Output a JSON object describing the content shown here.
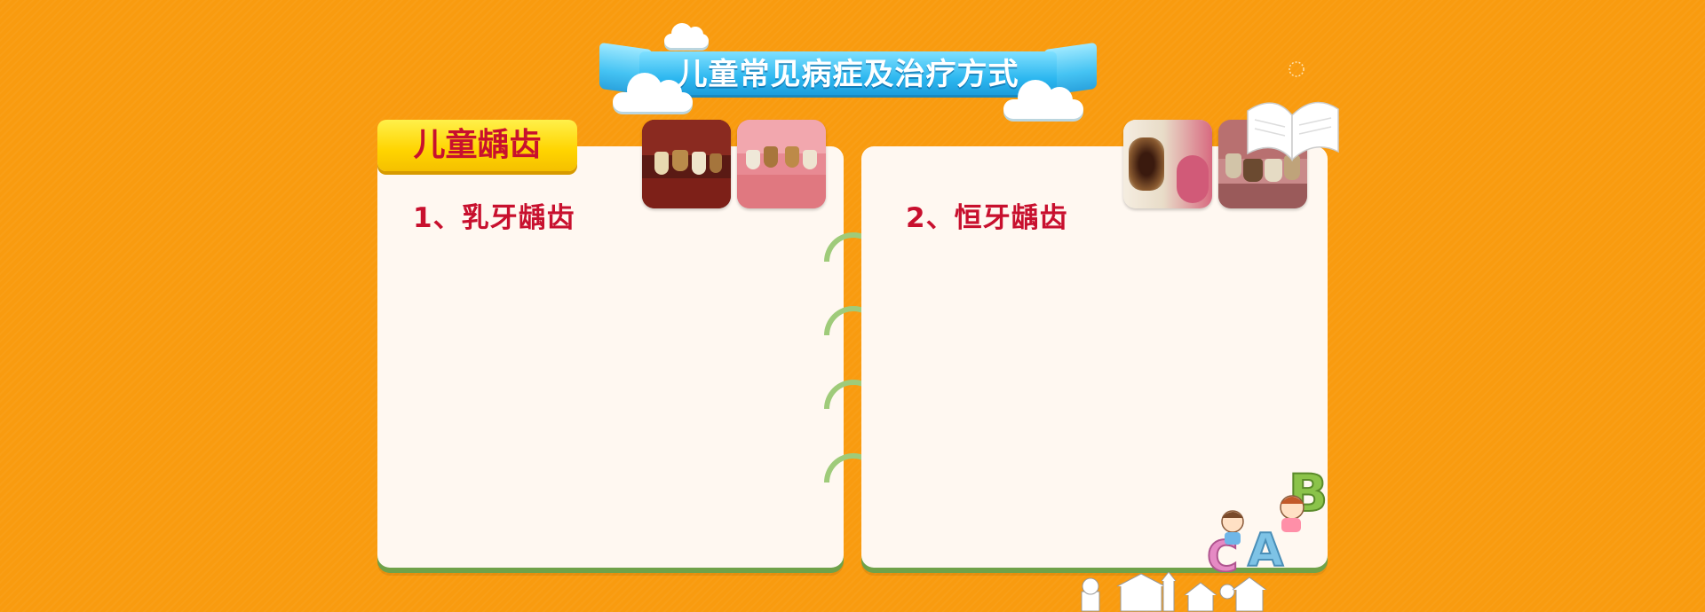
{
  "banner": {
    "title": "儿童常见病症及治疗方式"
  },
  "tab": {
    "label": "儿童龋齿"
  },
  "left_panel": {
    "heading": "1、乳牙龋齿"
  },
  "right_panel": {
    "heading": "2、恒牙龋齿"
  },
  "decor": {
    "letters": [
      "C",
      "A",
      "B"
    ],
    "colors": {
      "background": "#f99b0f",
      "panel": "#fff8f1",
      "panel_shadow": "#6fa24a",
      "ring": "#9fcb7a",
      "heading": "#c8102e",
      "banner": "#2bb6ef",
      "tab": "#ffd400"
    }
  }
}
